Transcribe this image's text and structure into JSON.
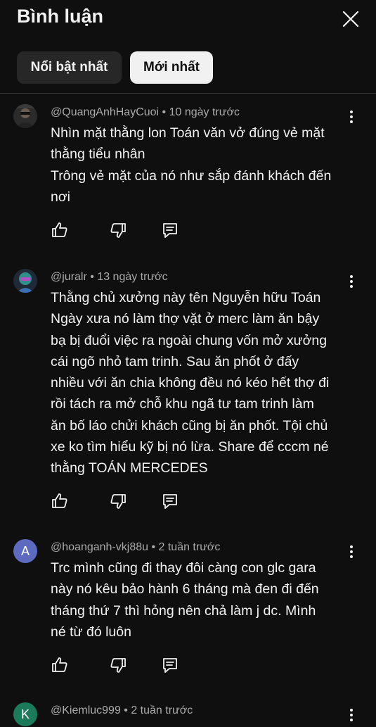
{
  "header": {
    "title": "Bình luận"
  },
  "filters": [
    {
      "label": "Nổi bật nhất",
      "active": false
    },
    {
      "label": "Mới nhất",
      "active": true
    }
  ],
  "comments": [
    {
      "author": "@QuangAnhHayCuoi",
      "time": "10 ngày trước",
      "meta": "@QuangAnhHayCuoi • 10 ngày trước",
      "text": "Nhìn mặt thằng lon Toán văn vở đúng vẻ mặt\nthằng tiểu nhân\nTrông vẻ mặt của nó như sắp đánh khách đến\nnơi",
      "avatar_type": "photo"
    },
    {
      "author": "@juralr",
      "time": "13 ngày trước",
      "meta": "@juralr • 13 ngày trước",
      "text": "Thằng chủ xưởng này tên Nguyễn hữu Toán\nNgày xưa nó làm thợ vặt ở merc làm ăn bậy\nbạ bị đuổi việc ra ngoài chung vốn mở xưởng\ncái ngõ nhỏ tam trinh. Sau ăn phốt ở đấy\nnhiều với ăn chia không đều nó kéo hết thợ đi\nrồi tách ra mở chỗ khu ngã tư tam trinh làm\năn bố láo chửi khách cũng bị ăn phốt. Tội chủ\nxe ko tìm hiểu kỹ bị nó lừa.  Share để cccm né\nthằng TOÁN MERCEDES",
      "avatar_type": "photo"
    },
    {
      "author": "@hoanganh-vkj88u",
      "time": "2 tuần trước",
      "meta": "@hoanganh-vkj88u • 2 tuần trước",
      "text": "Trc mình cũng đi thay đôi càng con glc gara\nnày nó kêu bảo hành 6 tháng mà đen đi đến\ntháng thứ 7 thì hỏng nên chả làm j dc. Mình\nné từ đó luôn",
      "avatar_letter": "A",
      "avatar_color": "#5c6bc0"
    },
    {
      "author": "@Kiemluc999",
      "time": "2 tuần trước",
      "meta": "@Kiemluc999 • 2 tuần trước",
      "avatar_letter": "K",
      "avatar_color": "#1b7a5a"
    }
  ],
  "icons": {
    "close": "close-icon",
    "like": "thumbs-up-icon",
    "dislike": "thumbs-down-icon",
    "reply": "reply-icon",
    "more": "more-vertical-icon"
  }
}
